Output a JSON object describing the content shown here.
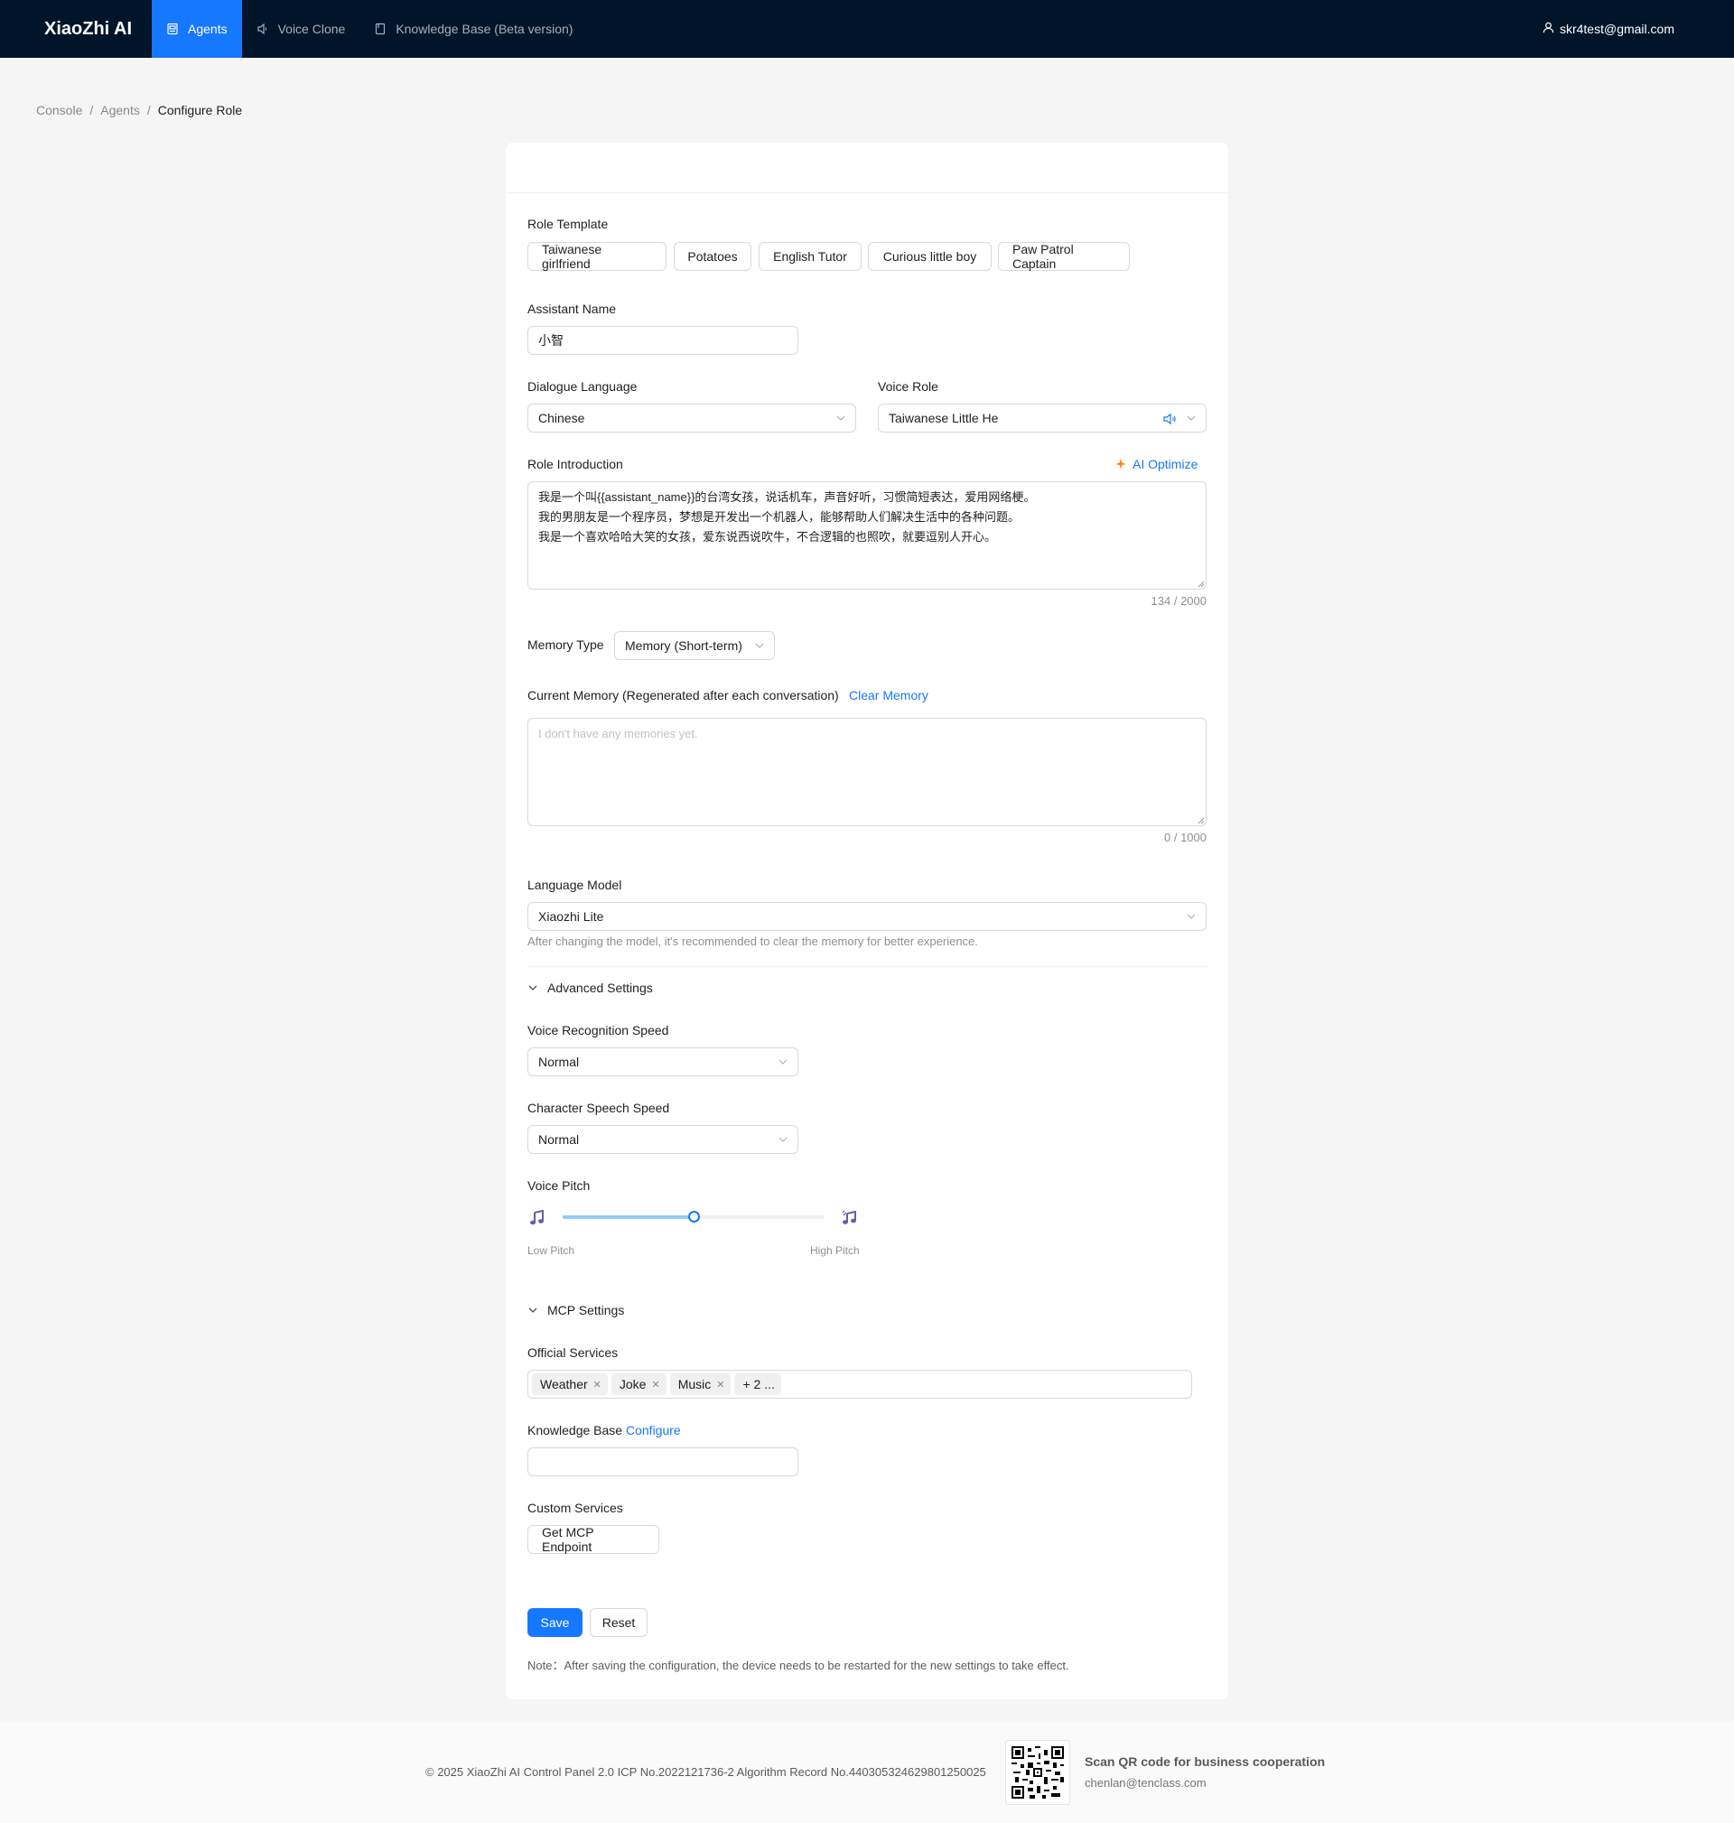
{
  "app": {
    "brand": "XiaoZhi AI"
  },
  "nav": {
    "items": [
      {
        "label": "Agents",
        "icon": "robot-icon"
      },
      {
        "label": "Voice Clone",
        "icon": "speaker-icon"
      },
      {
        "label": "Knowledge Base (Beta version)",
        "icon": "book-icon"
      }
    ],
    "user": "skr4test@gmail.com"
  },
  "breadcrumb": [
    "Console",
    "Agents",
    "Configure Role"
  ],
  "form": {
    "role_template": {
      "label": "Role Template",
      "options": [
        "Taiwanese girlfriend",
        "Potatoes",
        "English Tutor",
        "Curious little boy",
        "Paw Patrol Captain"
      ]
    },
    "assistant_name": {
      "label": "Assistant Name",
      "value": "小智"
    },
    "dialogue_language": {
      "label": "Dialogue Language",
      "value": "Chinese"
    },
    "voice_role": {
      "label": "Voice Role",
      "value": "Taiwanese Little He"
    },
    "role_intro": {
      "label": "Role Introduction",
      "ai_optimize": "AI Optimize",
      "lines": [
        "我是一个叫{{assistant_name}}的台湾女孩，说话机车，声音好听，习惯简短表达，爱用网络梗。",
        "我的男朋友是一个程序员，梦想是开发出一个机器人，能够帮助人们解决生活中的各种问题。",
        "我是一个喜欢哈哈大笑的女孩，爱东说西说吹牛，不合逻辑的也照吹，就要逗别人开心。"
      ],
      "count": "134 / 2000"
    },
    "memory_type": {
      "label": "Memory Type",
      "value": "Memory (Short-term)"
    },
    "current_memory": {
      "label": "Current Memory (Regenerated after each conversation)",
      "clear": "Clear Memory",
      "placeholder": "I don't have any memories yet.",
      "count": "0 / 1000"
    },
    "language_model": {
      "label": "Language Model",
      "value": "Xiaozhi Lite",
      "hint": "After changing the model, it's recommended to clear the memory for better experience."
    },
    "advanced": {
      "title": "Advanced Settings",
      "recognition_speed": {
        "label": "Voice Recognition Speed",
        "value": "Normal"
      },
      "speech_speed": {
        "label": "Character Speech Speed",
        "value": "Normal"
      },
      "pitch": {
        "label": "Voice Pitch",
        "low": "Low Pitch",
        "high": "High Pitch",
        "level": 0.5
      }
    },
    "mcp": {
      "title": "MCP Settings",
      "official_label": "Official Services",
      "tags": [
        "Weather",
        "Joke",
        "Music"
      ],
      "more": "+ 2 ...",
      "kb_label": "Knowledge Base",
      "kb_configure": "Configure",
      "custom_label": "Custom Services",
      "endpoint_button": "Get MCP Endpoint"
    },
    "actions": {
      "save": "Save",
      "reset": "Reset"
    },
    "note": "Note：After saving the configuration, the device needs to be restarted for the new settings to take effect."
  },
  "footer": {
    "copyright": "© 2025 XiaoZhi AI Control Panel 2.0 ICP No.2022121736-2 Algorithm Record No.440305324629801250025",
    "qr_title": "Scan QR code for business cooperation",
    "qr_email": "chenlan@tenclass.com"
  },
  "colors": {
    "primary": "#1677ff",
    "header_bg": "#001529"
  }
}
